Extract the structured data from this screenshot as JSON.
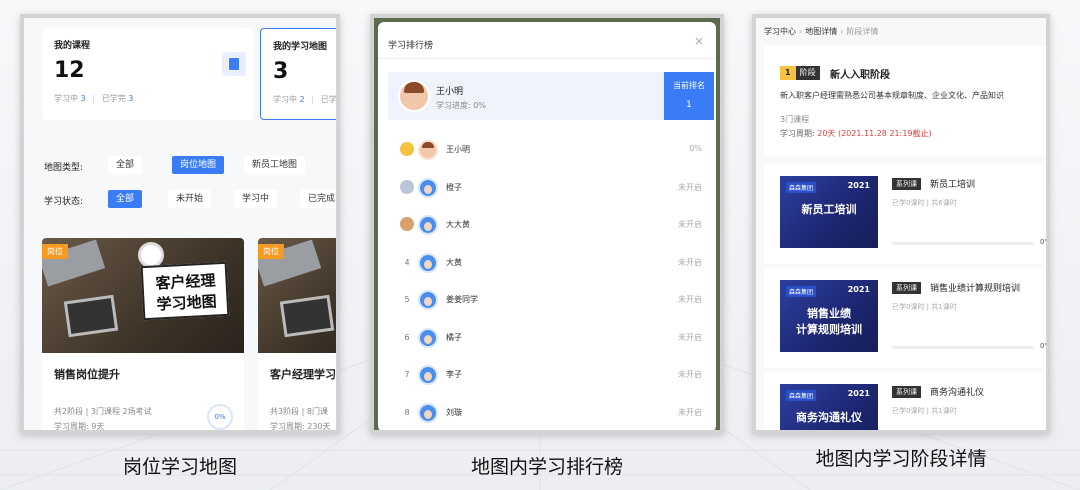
{
  "captions": {
    "left": "岗位学习地图",
    "middle": "地图内学习排行榜",
    "right": "地图内学习阶段详情"
  },
  "panel1": {
    "my_courses": {
      "title": "我的课程",
      "count": "12",
      "in_progress_label": "学习中",
      "in_progress": "3",
      "done_label": "已学完",
      "done": "3"
    },
    "my_maps": {
      "title": "我的学习地图",
      "count": "3",
      "in_progress_label": "学习中",
      "in_progress": "2",
      "done_label": "已学"
    },
    "map_type_label": "地图类型:",
    "map_types": [
      "全部",
      "岗位地图",
      "新员工地图"
    ],
    "map_type_selected": "岗位地图",
    "status_label": "学习状态:",
    "statuses": [
      "全部",
      "未开始",
      "学习中",
      "已完成"
    ],
    "status_selected": "全部",
    "cards": [
      {
        "tag": "岗位",
        "image_text": "客户经理 学习地图",
        "title": "销售岗位提升",
        "meta": "共2阶段 | 3门课程  2场考试",
        "period": "学习周期: 9天",
        "progress": "0%"
      },
      {
        "tag": "岗位",
        "title": "客户经理学习",
        "meta": "共3阶段 | 8门课",
        "period": "学习周期: 230天"
      }
    ]
  },
  "panel2": {
    "title": "学习排行榜",
    "close": "×",
    "me": {
      "name": "王小明",
      "progress": "学习进度: 0%",
      "rank_label": "当前排名",
      "rank": "1"
    },
    "rows": [
      {
        "rank": "1",
        "name": "王小明",
        "status": "0%",
        "avatar": "girl"
      },
      {
        "rank": "2",
        "name": "橙子",
        "status": "未开启",
        "avatar": "boy"
      },
      {
        "rank": "3",
        "name": "大大黄",
        "status": "未开启",
        "avatar": "boy"
      },
      {
        "rank": "4",
        "name": "大黄",
        "status": "未开启",
        "avatar": "boy"
      },
      {
        "rank": "5",
        "name": "姜姜同学",
        "status": "未开启",
        "avatar": "boy"
      },
      {
        "rank": "6",
        "name": "橘子",
        "status": "未开启",
        "avatar": "boy"
      },
      {
        "rank": "7",
        "name": "李子",
        "status": "未开启",
        "avatar": "boy"
      },
      {
        "rank": "8",
        "name": "刘璇",
        "status": "未开启",
        "avatar": "boy"
      }
    ],
    "colors": {
      "gold": "#f5c242",
      "silver": "#b9c6d6",
      "bronze": "#d9a06b"
    }
  },
  "panel3": {
    "breadcrumb": [
      "学习中心",
      "地图详情",
      "阶段详情"
    ],
    "stage": {
      "num": "1",
      "num_suffix": "阶段",
      "name": "新人入职阶段",
      "desc": "新入职客户经理需熟悉公司基本规章制度、企业文化、产品知识",
      "count": "3门课程",
      "period_label": "学习周期: ",
      "period_value": "20天 (2021.11.28 21:19截止)"
    },
    "lessons": [
      {
        "brand": "森森集团",
        "year": "2021",
        "cover": "新员工培训",
        "tag": "系列课",
        "title": "新员工培训",
        "meta": "已学0课时  |  共6课时",
        "pct": "0%"
      },
      {
        "brand": "森森集团",
        "year": "2021",
        "cover": "销售业绩\n计算规则培训",
        "tag": "系列课",
        "title": "销售业绩计算规则培训",
        "meta": "已学0课时  |  共1课时",
        "pct": "0%"
      },
      {
        "brand": "森森集团",
        "year": "2021",
        "cover": "商务沟通礼仪",
        "tag": "系列课",
        "title": "商务沟通礼仪",
        "meta": "已学0课时  |  共1课时"
      }
    ]
  }
}
